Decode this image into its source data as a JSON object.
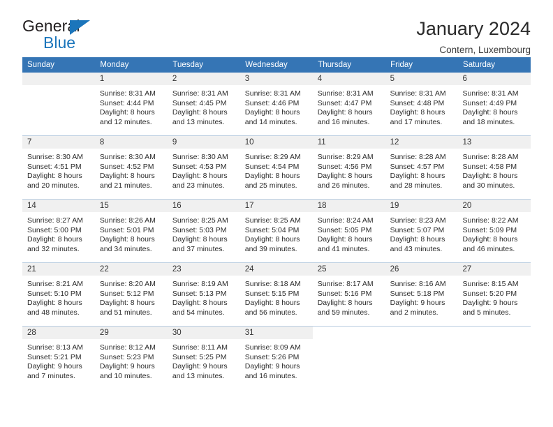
{
  "brand": {
    "name_top": "General",
    "name_bottom": "Blue",
    "triangle_color": "#1b75bb"
  },
  "header": {
    "title": "January 2024",
    "subtitle": "Contern, Luxembourg",
    "accent_color": "#3575b5"
  },
  "weekday_headers": [
    "Sunday",
    "Monday",
    "Tuesday",
    "Wednesday",
    "Thursday",
    "Friday",
    "Saturday"
  ],
  "weeks": [
    [
      {
        "day": "",
        "sunrise": "",
        "sunset": "",
        "daylight1": "",
        "daylight2": ""
      },
      {
        "day": "1",
        "sunrise": "Sunrise: 8:31 AM",
        "sunset": "Sunset: 4:44 PM",
        "daylight1": "Daylight: 8 hours",
        "daylight2": "and 12 minutes."
      },
      {
        "day": "2",
        "sunrise": "Sunrise: 8:31 AM",
        "sunset": "Sunset: 4:45 PM",
        "daylight1": "Daylight: 8 hours",
        "daylight2": "and 13 minutes."
      },
      {
        "day": "3",
        "sunrise": "Sunrise: 8:31 AM",
        "sunset": "Sunset: 4:46 PM",
        "daylight1": "Daylight: 8 hours",
        "daylight2": "and 14 minutes."
      },
      {
        "day": "4",
        "sunrise": "Sunrise: 8:31 AM",
        "sunset": "Sunset: 4:47 PM",
        "daylight1": "Daylight: 8 hours",
        "daylight2": "and 16 minutes."
      },
      {
        "day": "5",
        "sunrise": "Sunrise: 8:31 AM",
        "sunset": "Sunset: 4:48 PM",
        "daylight1": "Daylight: 8 hours",
        "daylight2": "and 17 minutes."
      },
      {
        "day": "6",
        "sunrise": "Sunrise: 8:31 AM",
        "sunset": "Sunset: 4:49 PM",
        "daylight1": "Daylight: 8 hours",
        "daylight2": "and 18 minutes."
      }
    ],
    [
      {
        "day": "7",
        "sunrise": "Sunrise: 8:30 AM",
        "sunset": "Sunset: 4:51 PM",
        "daylight1": "Daylight: 8 hours",
        "daylight2": "and 20 minutes."
      },
      {
        "day": "8",
        "sunrise": "Sunrise: 8:30 AM",
        "sunset": "Sunset: 4:52 PM",
        "daylight1": "Daylight: 8 hours",
        "daylight2": "and 21 minutes."
      },
      {
        "day": "9",
        "sunrise": "Sunrise: 8:30 AM",
        "sunset": "Sunset: 4:53 PM",
        "daylight1": "Daylight: 8 hours",
        "daylight2": "and 23 minutes."
      },
      {
        "day": "10",
        "sunrise": "Sunrise: 8:29 AM",
        "sunset": "Sunset: 4:54 PM",
        "daylight1": "Daylight: 8 hours",
        "daylight2": "and 25 minutes."
      },
      {
        "day": "11",
        "sunrise": "Sunrise: 8:29 AM",
        "sunset": "Sunset: 4:56 PM",
        "daylight1": "Daylight: 8 hours",
        "daylight2": "and 26 minutes."
      },
      {
        "day": "12",
        "sunrise": "Sunrise: 8:28 AM",
        "sunset": "Sunset: 4:57 PM",
        "daylight1": "Daylight: 8 hours",
        "daylight2": "and 28 minutes."
      },
      {
        "day": "13",
        "sunrise": "Sunrise: 8:28 AM",
        "sunset": "Sunset: 4:58 PM",
        "daylight1": "Daylight: 8 hours",
        "daylight2": "and 30 minutes."
      }
    ],
    [
      {
        "day": "14",
        "sunrise": "Sunrise: 8:27 AM",
        "sunset": "Sunset: 5:00 PM",
        "daylight1": "Daylight: 8 hours",
        "daylight2": "and 32 minutes."
      },
      {
        "day": "15",
        "sunrise": "Sunrise: 8:26 AM",
        "sunset": "Sunset: 5:01 PM",
        "daylight1": "Daylight: 8 hours",
        "daylight2": "and 34 minutes."
      },
      {
        "day": "16",
        "sunrise": "Sunrise: 8:25 AM",
        "sunset": "Sunset: 5:03 PM",
        "daylight1": "Daylight: 8 hours",
        "daylight2": "and 37 minutes."
      },
      {
        "day": "17",
        "sunrise": "Sunrise: 8:25 AM",
        "sunset": "Sunset: 5:04 PM",
        "daylight1": "Daylight: 8 hours",
        "daylight2": "and 39 minutes."
      },
      {
        "day": "18",
        "sunrise": "Sunrise: 8:24 AM",
        "sunset": "Sunset: 5:05 PM",
        "daylight1": "Daylight: 8 hours",
        "daylight2": "and 41 minutes."
      },
      {
        "day": "19",
        "sunrise": "Sunrise: 8:23 AM",
        "sunset": "Sunset: 5:07 PM",
        "daylight1": "Daylight: 8 hours",
        "daylight2": "and 43 minutes."
      },
      {
        "day": "20",
        "sunrise": "Sunrise: 8:22 AM",
        "sunset": "Sunset: 5:09 PM",
        "daylight1": "Daylight: 8 hours",
        "daylight2": "and 46 minutes."
      }
    ],
    [
      {
        "day": "21",
        "sunrise": "Sunrise: 8:21 AM",
        "sunset": "Sunset: 5:10 PM",
        "daylight1": "Daylight: 8 hours",
        "daylight2": "and 48 minutes."
      },
      {
        "day": "22",
        "sunrise": "Sunrise: 8:20 AM",
        "sunset": "Sunset: 5:12 PM",
        "daylight1": "Daylight: 8 hours",
        "daylight2": "and 51 minutes."
      },
      {
        "day": "23",
        "sunrise": "Sunrise: 8:19 AM",
        "sunset": "Sunset: 5:13 PM",
        "daylight1": "Daylight: 8 hours",
        "daylight2": "and 54 minutes."
      },
      {
        "day": "24",
        "sunrise": "Sunrise: 8:18 AM",
        "sunset": "Sunset: 5:15 PM",
        "daylight1": "Daylight: 8 hours",
        "daylight2": "and 56 minutes."
      },
      {
        "day": "25",
        "sunrise": "Sunrise: 8:17 AM",
        "sunset": "Sunset: 5:16 PM",
        "daylight1": "Daylight: 8 hours",
        "daylight2": "and 59 minutes."
      },
      {
        "day": "26",
        "sunrise": "Sunrise: 8:16 AM",
        "sunset": "Sunset: 5:18 PM",
        "daylight1": "Daylight: 9 hours",
        "daylight2": "and 2 minutes."
      },
      {
        "day": "27",
        "sunrise": "Sunrise: 8:15 AM",
        "sunset": "Sunset: 5:20 PM",
        "daylight1": "Daylight: 9 hours",
        "daylight2": "and 5 minutes."
      }
    ],
    [
      {
        "day": "28",
        "sunrise": "Sunrise: 8:13 AM",
        "sunset": "Sunset: 5:21 PM",
        "daylight1": "Daylight: 9 hours",
        "daylight2": "and 7 minutes."
      },
      {
        "day": "29",
        "sunrise": "Sunrise: 8:12 AM",
        "sunset": "Sunset: 5:23 PM",
        "daylight1": "Daylight: 9 hours",
        "daylight2": "and 10 minutes."
      },
      {
        "day": "30",
        "sunrise": "Sunrise: 8:11 AM",
        "sunset": "Sunset: 5:25 PM",
        "daylight1": "Daylight: 9 hours",
        "daylight2": "and 13 minutes."
      },
      {
        "day": "31",
        "sunrise": "Sunrise: 8:09 AM",
        "sunset": "Sunset: 5:26 PM",
        "daylight1": "Daylight: 9 hours",
        "daylight2": "and 16 minutes."
      },
      {
        "day": "",
        "sunrise": "",
        "sunset": "",
        "daylight1": "",
        "daylight2": ""
      },
      {
        "day": "",
        "sunrise": "",
        "sunset": "",
        "daylight1": "",
        "daylight2": ""
      },
      {
        "day": "",
        "sunrise": "",
        "sunset": "",
        "daylight1": "",
        "daylight2": ""
      }
    ]
  ]
}
